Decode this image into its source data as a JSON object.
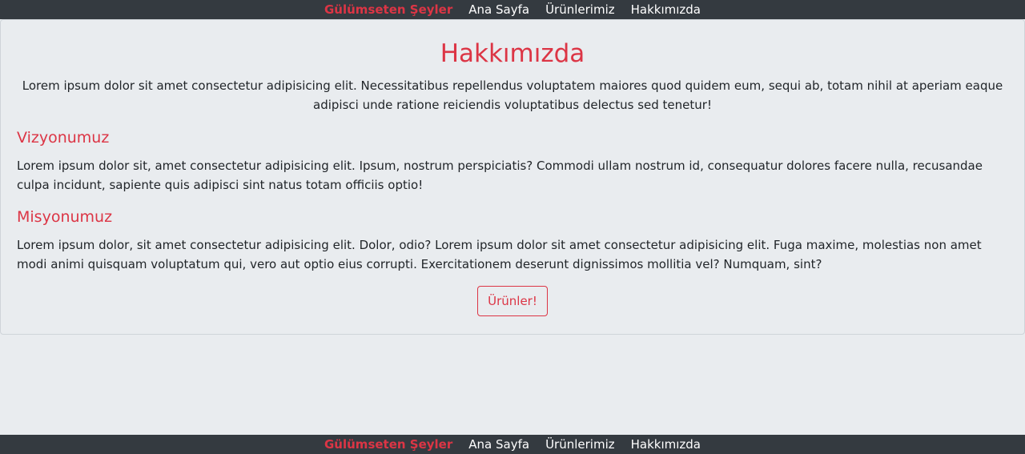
{
  "nav": {
    "brand": "Gülümseten Şeyler",
    "links": [
      "Ana Sayfa",
      "Ürünlerimiz",
      "Hakkımızda"
    ]
  },
  "about": {
    "title": "Hakkımızda",
    "intro": "Lorem ipsum dolor sit amet consectetur adipisicing elit. Necessitatibus repellendus voluptatem maiores quod quidem eum, sequi ab, totam nihil at aperiam eaque adipisci unde ratione reiciendis voluptatibus delectus sed tenetur!",
    "vision_title": "Vizyonumuz",
    "vision_text": "Lorem ipsum dolor sit, amet consectetur adipisicing elit. Ipsum, nostrum perspiciatis? Commodi ullam nostrum id, consequatur dolores facere nulla, recusandae culpa incidunt, sapiente quis adipisci sint natus totam officiis optio!",
    "mission_title": "Misyonumuz",
    "mission_text": "Lorem ipsum dolor, sit amet consectetur adipisicing elit. Dolor, odio? Lorem ipsum dolor sit amet consectetur adipisicing elit. Fuga maxime, molestias non amet modi animi quisquam voluptatum qui, vero aut optio eius corrupti. Exercitationem deserunt dignissimos mollitia vel? Numquam, sint?",
    "button_label": "Ürünler!"
  },
  "colors": {
    "accent": "#dc3545",
    "navbar": "#343a40",
    "background": "#e9ecef"
  }
}
